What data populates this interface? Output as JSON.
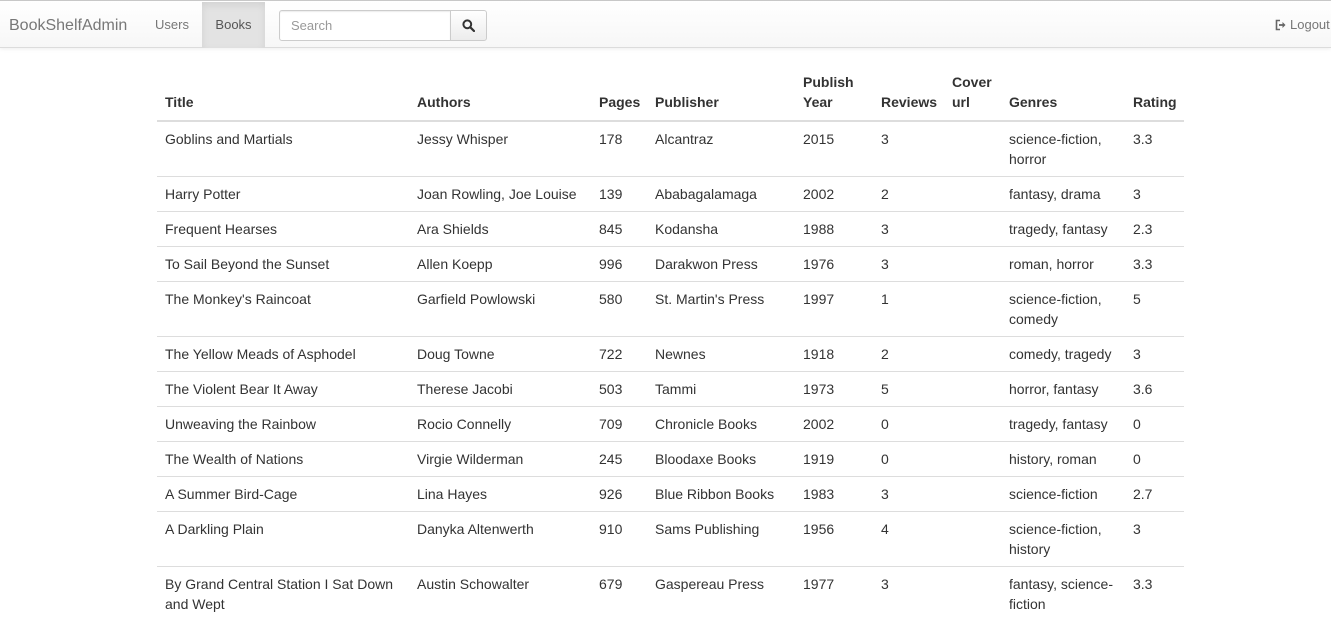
{
  "navbar": {
    "brand": "BookShelfAdmin",
    "links": [
      "Users",
      "Books"
    ],
    "active": "Books",
    "search": {
      "placeholder": "Search",
      "value": ""
    },
    "search_icon": "search-icon",
    "logout_icon": "logout-icon",
    "logout_label": "Logout"
  },
  "table": {
    "columns": [
      "Title",
      "Authors",
      "Pages",
      "Publisher",
      "Publish Year",
      "Reviews",
      "Cover url",
      "Genres",
      "Rating"
    ],
    "rows": [
      [
        "Goblins and Martials",
        "Jessy Whisper",
        "178",
        "Alcantraz",
        "2015",
        "3",
        "",
        "science-fiction, horror",
        "3.3"
      ],
      [
        "Harry Potter",
        "Joan Rowling, Joe Louise",
        "139",
        "Ababagalamaga",
        "2002",
        "2",
        "",
        "fantasy, drama",
        "3"
      ],
      [
        "Frequent Hearses",
        "Ara Shields",
        "845",
        "Kodansha",
        "1988",
        "3",
        "",
        "tragedy, fantasy",
        "2.3"
      ],
      [
        "To Sail Beyond the Sunset",
        "Allen Koepp",
        "996",
        "Darakwon Press",
        "1976",
        "3",
        "",
        "roman, horror",
        "3.3"
      ],
      [
        "The Monkey's Raincoat",
        "Garfield Powlowski",
        "580",
        "St. Martin's Press",
        "1997",
        "1",
        "",
        "science-fiction, comedy",
        "5"
      ],
      [
        "The Yellow Meads of Asphodel",
        "Doug Towne",
        "722",
        "Newnes",
        "1918",
        "2",
        "",
        "comedy, tragedy",
        "3"
      ],
      [
        "The Violent Bear It Away",
        "Therese Jacobi",
        "503",
        "Tammi",
        "1973",
        "5",
        "",
        "horror, fantasy",
        "3.6"
      ],
      [
        "Unweaving the Rainbow",
        "Rocio Connelly",
        "709",
        "Chronicle Books",
        "2002",
        "0",
        "",
        "tragedy, fantasy",
        "0"
      ],
      [
        "The Wealth of Nations",
        "Virgie Wilderman",
        "245",
        "Bloodaxe Books",
        "1919",
        "0",
        "",
        "history, roman",
        "0"
      ],
      [
        "A Summer Bird-Cage",
        "Lina Hayes",
        "926",
        "Blue Ribbon Books",
        "1983",
        "3",
        "",
        "science-fiction",
        "2.7"
      ],
      [
        "A Darkling Plain",
        "Danyka Altenwerth",
        "910",
        "Sams Publishing",
        "1956",
        "4",
        "",
        "science-fiction, history",
        "3"
      ],
      [
        "By Grand Central Station I Sat Down and Wept",
        "Austin Schowalter",
        "679",
        "Gaspereau Press",
        "1977",
        "3",
        "",
        "fantasy, science-fiction",
        "3.3"
      ]
    ]
  }
}
